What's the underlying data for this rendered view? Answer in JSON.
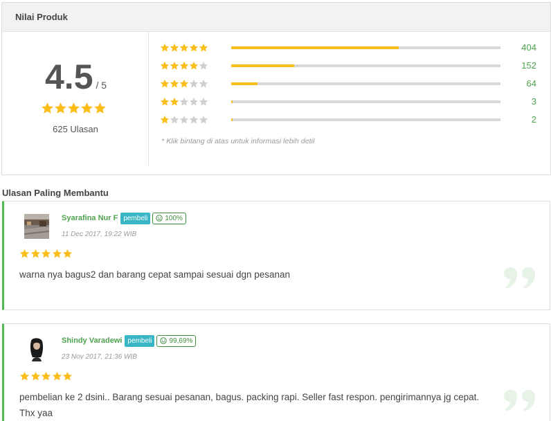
{
  "rating_summary": {
    "title": "Nilai Produk",
    "score": "4.5",
    "max_label": "/ 5",
    "average_stars": 5,
    "review_count_label": "625 Ulasan",
    "breakdown": [
      {
        "stars": 5,
        "count": "404"
      },
      {
        "stars": 4,
        "count": "152"
      },
      {
        "stars": 3,
        "count": "64"
      },
      {
        "stars": 2,
        "count": "3"
      },
      {
        "stars": 1,
        "count": "2"
      }
    ],
    "note": "* Klik bintang di atas untuk informasi lebih detil"
  },
  "reviews_section": {
    "title": "Ulasan Paling Membantu",
    "reviews": [
      {
        "name": "Syarafina Nur F",
        "badge": "pembeli",
        "reputation": "100%",
        "date": "11 Dec 2017, 19:22 WIB",
        "stars": 5,
        "text": "warna nya bagus2 dan barang cepat sampai sesuai dgn pesanan"
      },
      {
        "name": "Shindy Varadewi",
        "badge": "pembeli",
        "reputation": "99,69%",
        "date": "23 Nov 2017, 21:36 WIB",
        "stars": 5,
        "text": "pembelian ke 2 dsini.. Barang sesuai pesanan, bagus. packing rapi. Seller fast respon. pengirimannya jg cepat. Thx yaa"
      }
    ]
  },
  "colors": {
    "star_filled": "#fbbd1a",
    "star_empty": "#cfcfcf",
    "accent_green": "#4fa34f",
    "badge_blue": "#39b6c5",
    "quote_green": "#e6f3e6"
  },
  "icons": {
    "star": "star-icon",
    "smile": "smile-icon",
    "quote": "quote-icon"
  }
}
